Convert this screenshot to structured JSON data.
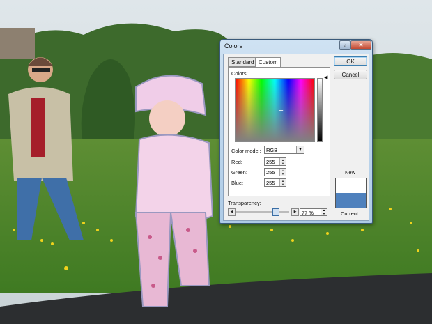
{
  "dialog": {
    "title": "Colors",
    "help_label": "?",
    "close_label": "✕",
    "tabs": [
      {
        "label": "Standard",
        "selected": false
      },
      {
        "label": "Custom",
        "selected": true
      }
    ],
    "colors_label": "Colors:",
    "color_model_label": "Color model:",
    "color_model_value": "RGB",
    "red_label": "Red:",
    "red_value": "255",
    "green_label": "Green:",
    "green_value": "255",
    "blue_label": "Blue:",
    "blue_value": "255",
    "transparency_label": "Transparency:",
    "transparency_value": "77 %",
    "transparency_fraction": 0.77,
    "ok_label": "OK",
    "cancel_label": "Cancel",
    "new_label": "New",
    "current_label": "Current",
    "new_color": "#ffffff",
    "current_color": "#4f81bd"
  },
  "icons": {
    "crosshair": "crosshair-icon",
    "dropdown": "chevron-down-icon",
    "spin": "spin-up-down-icon",
    "slider_left": "arrow-left-icon",
    "slider_right": "arrow-right-icon"
  }
}
